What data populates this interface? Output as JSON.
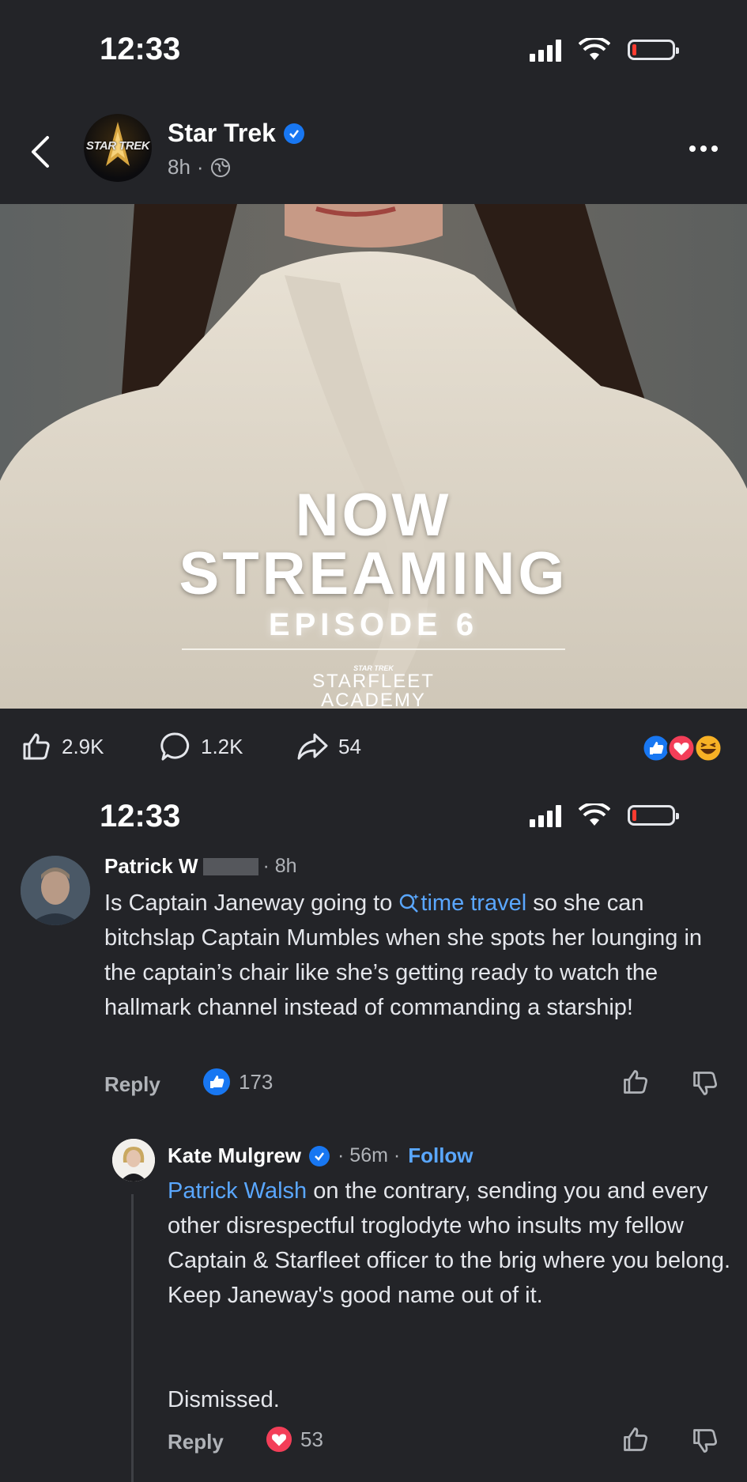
{
  "status_bar_top": {
    "time": "12:33"
  },
  "status_bar_mid": {
    "time": "12:33"
  },
  "post": {
    "page_name": "Star Trek",
    "page_avatar_text": "STAR TREK",
    "age": "8h",
    "separator": "·",
    "image": {
      "headline_line1": "NOW",
      "headline_line2": "STREAMING",
      "subheadline": "EPISODE 6",
      "logo_small": "STAR TREK",
      "logo_line1": "STARFLEET",
      "logo_line2": "ACADEMY"
    },
    "stats": {
      "likes": "2.9K",
      "comments": "1.2K",
      "shares": "54"
    }
  },
  "comments": [
    {
      "author": "Patrick W",
      "time": "· 8h",
      "text_before": "Is Captain Janeway going to ",
      "search_link": "time travel",
      "text_after": " so she can bitchslap Captain Mumbles when she spots her lounging in the captain’s chair like she’s getting ready to watch the hallmark channel instead of commanding a starship!",
      "reply_label": "Reply",
      "reaction_count": "173"
    },
    {
      "author": "Kate Mulgrew",
      "time": "· 56m ·",
      "follow_label": "Follow",
      "mention": "Patrick Walsh",
      "text": " on the contrary, sending you and every other disrespectful troglodyte who insults my fellow Captain & Starfleet officer to the brig where you belong. Keep Janeway's good name out of it.",
      "text2": "Dismissed.",
      "reply_label": "Reply",
      "reaction_count": "53"
    }
  ],
  "colors": {
    "background": "#232428",
    "link": "#5aa7ff",
    "verified": "#1877f2",
    "love": "#f33e58"
  }
}
